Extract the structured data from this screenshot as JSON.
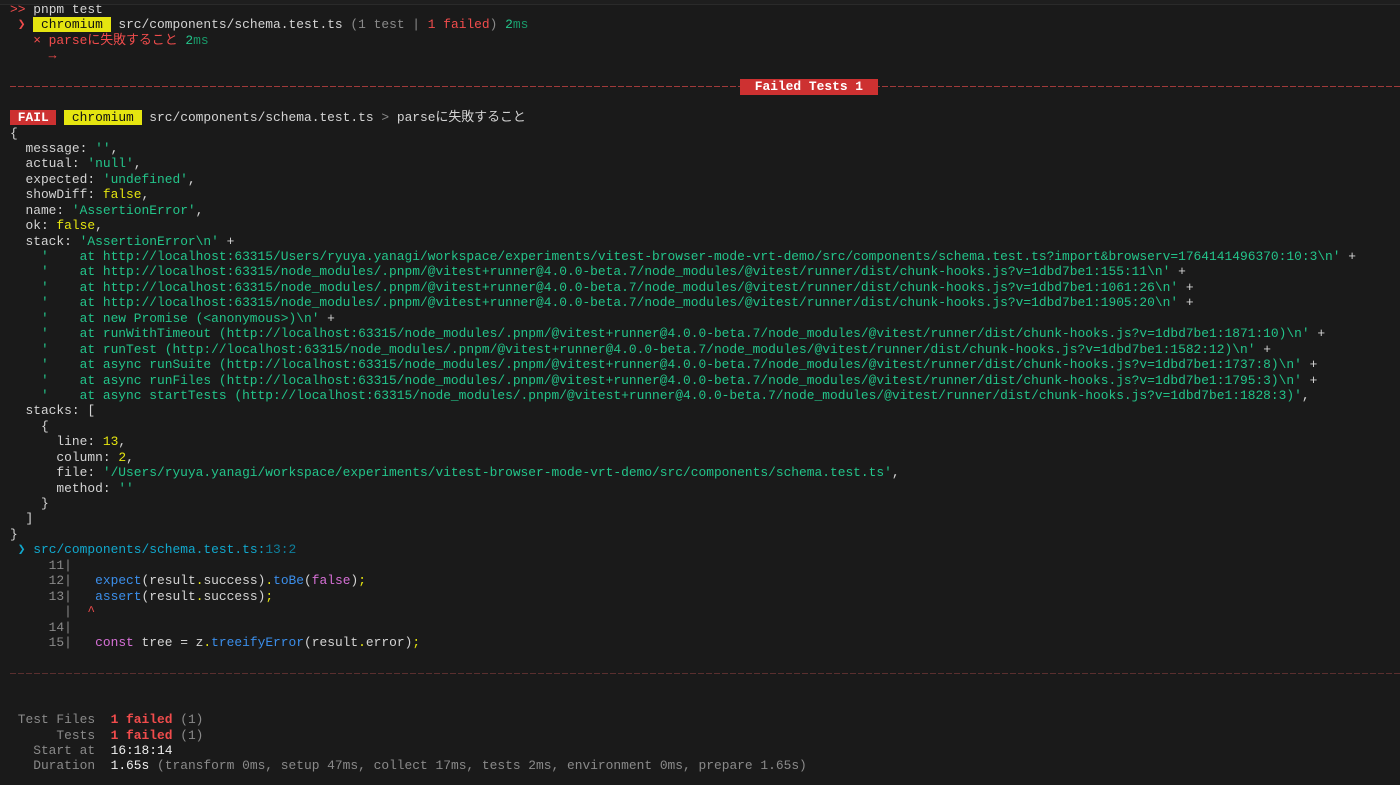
{
  "colors": {
    "background": "#1a1a1a",
    "fail_badge": "#cd3131",
    "browser_badge": "#e5e510",
    "string": "#23c48a",
    "error": "#f14c4c"
  },
  "terminal": {
    "lines": [
      {
        "name": "command-line",
        "segs": [
          {
            "t": ">>",
            "c": "red"
          },
          {
            "t": " pnpm test",
            "c": "fg"
          }
        ]
      },
      {
        "name": "test-file-result",
        "segs": [
          {
            "t": " ❯ ",
            "c": "red"
          },
          {
            "t": " chromium ",
            "c": "badge-y"
          },
          {
            "t": " src/components/schema.test.ts ",
            "c": "fg"
          },
          {
            "t": "(1 test | ",
            "c": "gray"
          },
          {
            "t": "1 failed",
            "c": "red"
          },
          {
            "t": ") ",
            "c": "gray"
          },
          {
            "t": "2",
            "c": "green"
          },
          {
            "t": "ms",
            "c": "dgreen"
          }
        ]
      },
      {
        "name": "test-case-result",
        "segs": [
          {
            "t": "   × parseに失敗すること ",
            "c": "red"
          },
          {
            "t": "2",
            "c": "green"
          },
          {
            "t": "ms",
            "c": "dgreen"
          }
        ]
      },
      {
        "name": "arrow-line",
        "segs": [
          {
            "t": "     →",
            "c": "red"
          }
        ]
      },
      {
        "name": "blank",
        "segs": []
      },
      {
        "name": "failed-tests-divider",
        "rule": true,
        "label": " Failed Tests 1 "
      },
      {
        "name": "blank",
        "segs": []
      },
      {
        "name": "fail-header",
        "segs": [
          {
            "t": " FAIL ",
            "c": "badge-r"
          },
          {
            "t": " ",
            "c": "fg"
          },
          {
            "t": " chromium ",
            "c": "badge-y"
          },
          {
            "t": " src/components/schema.test.ts ",
            "c": "fg"
          },
          {
            "t": ">",
            "c": "gray"
          },
          {
            "t": " parseに失敗すること",
            "c": "fg"
          }
        ]
      },
      {
        "name": "error-object-open",
        "segs": [
          {
            "t": "{",
            "c": "fg"
          }
        ]
      },
      {
        "name": "error-prop-message",
        "segs": [
          {
            "t": "  message: ",
            "c": "fg"
          },
          {
            "t": "''",
            "c": "green"
          },
          {
            "t": ",",
            "c": "fg"
          }
        ]
      },
      {
        "name": "error-prop-actual",
        "segs": [
          {
            "t": "  actual: ",
            "c": "fg"
          },
          {
            "t": "'null'",
            "c": "green"
          },
          {
            "t": ",",
            "c": "fg"
          }
        ]
      },
      {
        "name": "error-prop-expected",
        "segs": [
          {
            "t": "  expected: ",
            "c": "fg"
          },
          {
            "t": "'undefined'",
            "c": "green"
          },
          {
            "t": ",",
            "c": "fg"
          }
        ]
      },
      {
        "name": "error-prop-showdiff",
        "segs": [
          {
            "t": "  showDiff: ",
            "c": "fg"
          },
          {
            "t": "false",
            "c": "yellow"
          },
          {
            "t": ",",
            "c": "fg"
          }
        ]
      },
      {
        "name": "error-prop-name",
        "segs": [
          {
            "t": "  name: ",
            "c": "fg"
          },
          {
            "t": "'AssertionError'",
            "c": "green"
          },
          {
            "t": ",",
            "c": "fg"
          }
        ]
      },
      {
        "name": "error-prop-ok",
        "segs": [
          {
            "t": "  ok: ",
            "c": "fg"
          },
          {
            "t": "false",
            "c": "yellow"
          },
          {
            "t": ",",
            "c": "fg"
          }
        ]
      },
      {
        "name": "error-prop-stack",
        "segs": [
          {
            "t": "  stack: ",
            "c": "fg"
          },
          {
            "t": "'AssertionError\\n'",
            "c": "green"
          },
          {
            "t": " +",
            "c": "fg"
          }
        ]
      },
      {
        "name": "stack-frame",
        "segs": [
          {
            "t": "    '    at http://localhost:63315/Users/ryuya.yanagi/workspace/experiments/vitest-browser-mode-vrt-demo/src/components/schema.test.ts?import&browserv=1764141496370:10:3\\n'",
            "c": "green"
          },
          {
            "t": " +",
            "c": "fg"
          }
        ]
      },
      {
        "name": "stack-frame",
        "segs": [
          {
            "t": "    '    at http://localhost:63315/node_modules/.pnpm/@vitest+runner@4.0.0-beta.7/node_modules/@vitest/runner/dist/chunk-hooks.js?v=1dbd7be1:155:11\\n'",
            "c": "green"
          },
          {
            "t": " +",
            "c": "fg"
          }
        ]
      },
      {
        "name": "stack-frame",
        "segs": [
          {
            "t": "    '    at http://localhost:63315/node_modules/.pnpm/@vitest+runner@4.0.0-beta.7/node_modules/@vitest/runner/dist/chunk-hooks.js?v=1dbd7be1:1061:26\\n'",
            "c": "green"
          },
          {
            "t": " +",
            "c": "fg"
          }
        ]
      },
      {
        "name": "stack-frame",
        "segs": [
          {
            "t": "    '    at http://localhost:63315/node_modules/.pnpm/@vitest+runner@4.0.0-beta.7/node_modules/@vitest/runner/dist/chunk-hooks.js?v=1dbd7be1:1905:20\\n'",
            "c": "green"
          },
          {
            "t": " +",
            "c": "fg"
          }
        ]
      },
      {
        "name": "stack-frame",
        "segs": [
          {
            "t": "    '    at new Promise (<anonymous>)\\n'",
            "c": "green"
          },
          {
            "t": " +",
            "c": "fg"
          }
        ]
      },
      {
        "name": "stack-frame",
        "segs": [
          {
            "t": "    '    at runWithTimeout (http://localhost:63315/node_modules/.pnpm/@vitest+runner@4.0.0-beta.7/node_modules/@vitest/runner/dist/chunk-hooks.js?v=1dbd7be1:1871:10)\\n'",
            "c": "green"
          },
          {
            "t": " +",
            "c": "fg"
          }
        ]
      },
      {
        "name": "stack-frame",
        "segs": [
          {
            "t": "    '    at runTest (http://localhost:63315/node_modules/.pnpm/@vitest+runner@4.0.0-beta.7/node_modules/@vitest/runner/dist/chunk-hooks.js?v=1dbd7be1:1582:12)\\n'",
            "c": "green"
          },
          {
            "t": " +",
            "c": "fg"
          }
        ]
      },
      {
        "name": "stack-frame",
        "segs": [
          {
            "t": "    '    at async runSuite (http://localhost:63315/node_modules/.pnpm/@vitest+runner@4.0.0-beta.7/node_modules/@vitest/runner/dist/chunk-hooks.js?v=1dbd7be1:1737:8)\\n'",
            "c": "green"
          },
          {
            "t": " +",
            "c": "fg"
          }
        ]
      },
      {
        "name": "stack-frame",
        "segs": [
          {
            "t": "    '    at async runFiles (http://localhost:63315/node_modules/.pnpm/@vitest+runner@4.0.0-beta.7/node_modules/@vitest/runner/dist/chunk-hooks.js?v=1dbd7be1:1795:3)\\n'",
            "c": "green"
          },
          {
            "t": " +",
            "c": "fg"
          }
        ]
      },
      {
        "name": "stack-frame",
        "segs": [
          {
            "t": "    '    at async startTests (http://localhost:63315/node_modules/.pnpm/@vitest+runner@4.0.0-beta.7/node_modules/@vitest/runner/dist/chunk-hooks.js?v=1dbd7be1:1828:3)'",
            "c": "green"
          },
          {
            "t": ",",
            "c": "fg"
          }
        ]
      },
      {
        "name": "error-prop-stacks",
        "segs": [
          {
            "t": "  stacks: [",
            "c": "fg"
          }
        ]
      },
      {
        "name": "stacks-item-open",
        "segs": [
          {
            "t": "    {",
            "c": "fg"
          }
        ]
      },
      {
        "name": "stacks-line",
        "segs": [
          {
            "t": "      line: ",
            "c": "fg"
          },
          {
            "t": "13",
            "c": "yellow"
          },
          {
            "t": ",",
            "c": "fg"
          }
        ]
      },
      {
        "name": "stacks-column",
        "segs": [
          {
            "t": "      column: ",
            "c": "fg"
          },
          {
            "t": "2",
            "c": "yellow"
          },
          {
            "t": ",",
            "c": "fg"
          }
        ]
      },
      {
        "name": "stacks-file",
        "segs": [
          {
            "t": "      file: ",
            "c": "fg"
          },
          {
            "t": "'/Users/ryuya.yanagi/workspace/experiments/vitest-browser-mode-vrt-demo/src/components/schema.test.ts'",
            "c": "green"
          },
          {
            "t": ",",
            "c": "fg"
          }
        ]
      },
      {
        "name": "stacks-method",
        "segs": [
          {
            "t": "      method: ",
            "c": "fg"
          },
          {
            "t": "''",
            "c": "green"
          }
        ]
      },
      {
        "name": "stacks-item-close",
        "segs": [
          {
            "t": "    }",
            "c": "fg"
          }
        ]
      },
      {
        "name": "stacks-close",
        "segs": [
          {
            "t": "  ]",
            "c": "fg"
          }
        ]
      },
      {
        "name": "error-object-close",
        "segs": [
          {
            "t": "}",
            "c": "fg"
          }
        ]
      },
      {
        "name": "code-frame-location",
        "link": true,
        "segs": [
          {
            "t": " ❯ ",
            "c": "cyan"
          },
          {
            "t": "src/components/schema.test.ts:",
            "c": "cyan"
          },
          {
            "t": "13:2",
            "c": "dcyan"
          }
        ]
      },
      {
        "name": "code-line-11",
        "segs": [
          {
            "t": "     11|",
            "c": "gray"
          }
        ]
      },
      {
        "name": "code-line-12",
        "segs": [
          {
            "t": "     12|",
            "c": "gray"
          },
          {
            "t": "   ",
            "c": "fg"
          },
          {
            "t": "expect",
            "c": "blue"
          },
          {
            "t": "(result",
            "c": "fg"
          },
          {
            "t": ".",
            "c": "yellow"
          },
          {
            "t": "success)",
            "c": "fg"
          },
          {
            "t": ".",
            "c": "yellow"
          },
          {
            "t": "toBe",
            "c": "blue"
          },
          {
            "t": "(",
            "c": "fg"
          },
          {
            "t": "false",
            "c": "magenta"
          },
          {
            "t": ")",
            "c": "fg"
          },
          {
            "t": ";",
            "c": "yellow"
          }
        ]
      },
      {
        "name": "code-line-13",
        "segs": [
          {
            "t": "     13|",
            "c": "gray"
          },
          {
            "t": "   ",
            "c": "fg"
          },
          {
            "t": "assert",
            "c": "blue"
          },
          {
            "t": "(result",
            "c": "fg"
          },
          {
            "t": ".",
            "c": "yellow"
          },
          {
            "t": "success)",
            "c": "fg"
          },
          {
            "t": ";",
            "c": "yellow"
          }
        ]
      },
      {
        "name": "code-caret-line",
        "segs": [
          {
            "t": "       |",
            "c": "gray"
          },
          {
            "t": "  ^",
            "c": "red"
          }
        ]
      },
      {
        "name": "code-line-14",
        "segs": [
          {
            "t": "     14|",
            "c": "gray"
          }
        ]
      },
      {
        "name": "code-line-15",
        "segs": [
          {
            "t": "     15|",
            "c": "gray"
          },
          {
            "t": "   ",
            "c": "fg"
          },
          {
            "t": "const",
            "c": "magenta"
          },
          {
            "t": " tree = z",
            "c": "fg"
          },
          {
            "t": ".",
            "c": "yellow"
          },
          {
            "t": "treeifyError",
            "c": "blue"
          },
          {
            "t": "(result",
            "c": "fg"
          },
          {
            "t": ".",
            "c": "yellow"
          },
          {
            "t": "error)",
            "c": "fg"
          },
          {
            "t": ";",
            "c": "yellow"
          }
        ]
      },
      {
        "name": "blank",
        "segs": []
      },
      {
        "name": "end-divider",
        "rule": true,
        "faint": true
      },
      {
        "name": "blank",
        "segs": []
      },
      {
        "name": "blank",
        "segs": []
      },
      {
        "name": "summary-test-files",
        "segs": [
          {
            "t": " Test Files  ",
            "c": "gray"
          },
          {
            "t": "1 failed",
            "c": "redbold"
          },
          {
            "t": " (1)",
            "c": "gray"
          }
        ]
      },
      {
        "name": "summary-tests",
        "segs": [
          {
            "t": "      Tests  ",
            "c": "gray"
          },
          {
            "t": "1 failed",
            "c": "redbold"
          },
          {
            "t": " (1)",
            "c": "gray"
          }
        ]
      },
      {
        "name": "summary-start-at",
        "segs": [
          {
            "t": "   Start at  ",
            "c": "gray"
          },
          {
            "t": "16:18:14",
            "c": "white"
          }
        ]
      },
      {
        "name": "summary-duration",
        "segs": [
          {
            "t": "   Duration  ",
            "c": "gray"
          },
          {
            "t": "1.65s",
            "c": "white"
          },
          {
            "t": " (transform 0ms, setup 47ms, collect 17ms, tests 2ms, environment 0ms, prepare 1.65s)",
            "c": "gray"
          }
        ]
      }
    ]
  }
}
